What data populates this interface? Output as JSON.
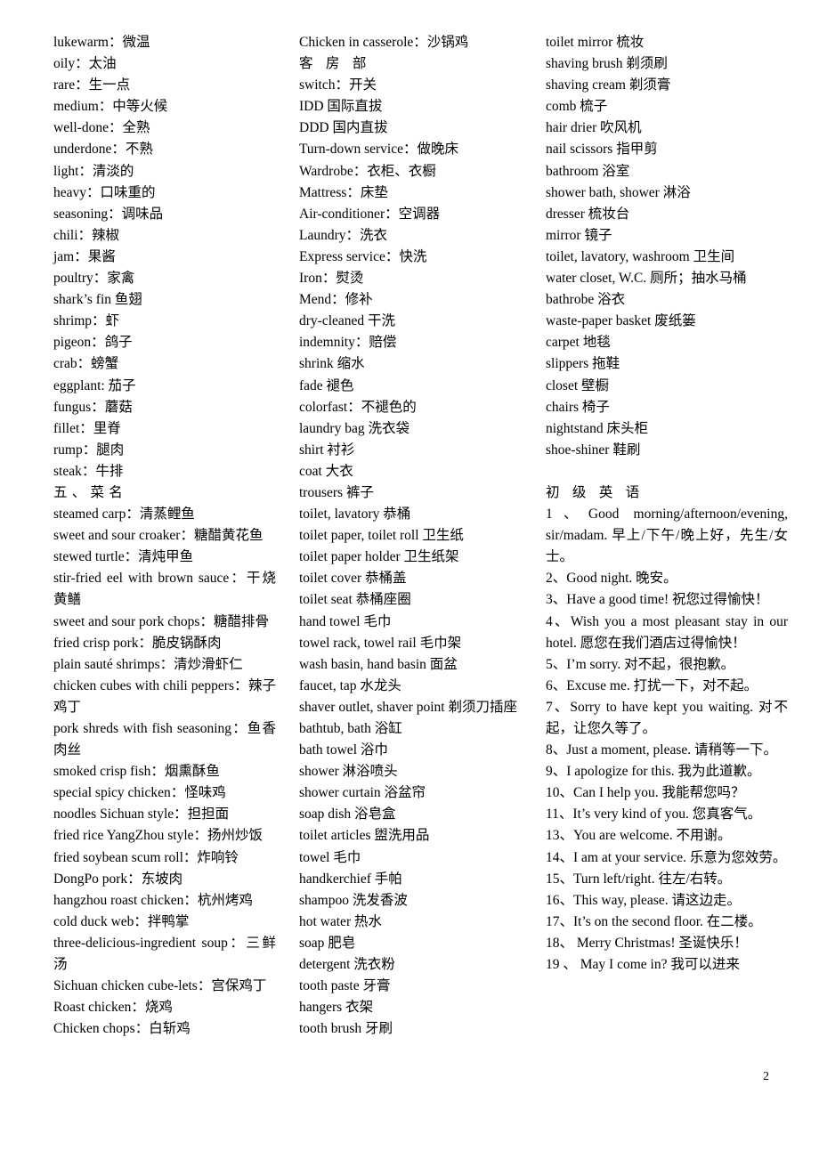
{
  "page": {
    "number": "2"
  },
  "columns": [
    {
      "id": "column-1",
      "entries": [
        {
          "text": "lukewarm：微温"
        },
        {
          "text": "oily：太油"
        },
        {
          "text": "rare：生一点"
        },
        {
          "text": "medium：中等火候"
        },
        {
          "text": "well-done：全熟"
        },
        {
          "text": "underdone：不熟"
        },
        {
          "text": "light：清淡的"
        },
        {
          "text": "heavy：口味重的"
        },
        {
          "text": "seasoning：调味品"
        },
        {
          "text": "chili：辣椒"
        },
        {
          "text": "jam：果酱"
        },
        {
          "text": "poultry：家禽"
        },
        {
          "text": "shark’s fin 鱼翅"
        },
        {
          "text": "shrimp：虾"
        },
        {
          "text": "pigeon：鸽子"
        },
        {
          "text": "crab：螃蟹"
        },
        {
          "text": "eggplant: 茄子"
        },
        {
          "text": "fungus：蘑菇"
        },
        {
          "text": "fillet：里脊"
        },
        {
          "text": "rump：腿肉"
        },
        {
          "text": "steak：牛排"
        },
        {
          "text": "五、菜名",
          "heading": true
        },
        {
          "text": "steamed carp：清蒸鲤鱼"
        },
        {
          "text": "sweet and sour croaker：糖醋黄花鱼"
        },
        {
          "text": "stewed turtle：清炖甲鱼"
        },
        {
          "text": "stir-fried eel with brown sauce：干烧黄鳝",
          "wrap": true
        },
        {
          "text": "sweet and sour pork chops：糖醋排骨",
          "wrap": true
        },
        {
          "text": "fried crisp pork：脆皮锅酥肉"
        },
        {
          "text": "plain sauté shrimps：清炒滑虾仁"
        },
        {
          "text": "chicken cubes with chili peppers：辣子鸡丁",
          "wrap": true
        },
        {
          "text": "pork shreds with fish seasoning：鱼香肉丝",
          "wrap": true
        },
        {
          "text": "smoked crisp fish：烟熏酥鱼"
        },
        {
          "text": "special spicy chicken：怪味鸡"
        },
        {
          "text": "noodles Sichuan style：担担面"
        },
        {
          "text": "fried rice YangZhou style：扬州炒饭"
        },
        {
          "text": "fried soybean scum roll：炸响铃"
        },
        {
          "text": "DongPo pork：东坡肉"
        },
        {
          "text": "hangzhou roast chicken：杭州烤鸡"
        },
        {
          "text": "cold duck web：拌鸭掌"
        },
        {
          "text": "three-delicious-ingredient soup：三鲜汤",
          "wrap": true
        },
        {
          "text": "Sichuan chicken cube-lets：宫保鸡丁"
        },
        {
          "text": "Roast chicken：烧鸡"
        },
        {
          "text": "Chicken chops：白斩鸡"
        }
      ]
    },
    {
      "id": "column-2",
      "entries": [
        {
          "text": "Chicken in casserole：沙锅鸡"
        },
        {
          "text": "客 房 部",
          "heading": true
        },
        {
          "text": "switch：开关"
        },
        {
          "text": "IDD 国际直拔"
        },
        {
          "text": "DDD 国内直拔"
        },
        {
          "text": "Turn-down service：做晚床"
        },
        {
          "text": "Wardrobe：衣柜、衣橱"
        },
        {
          "text": "Mattress：床垫"
        },
        {
          "text": "Air-conditioner：空调器"
        },
        {
          "text": "Laundry：洗衣"
        },
        {
          "text": "Express service：快洗"
        },
        {
          "text": "Iron：熨烫"
        },
        {
          "text": "Mend：修补"
        },
        {
          "text": "dry-cleaned 干洗"
        },
        {
          "text": "indemnity：赔偿"
        },
        {
          "text": "shrink 缩水"
        },
        {
          "text": "fade 褪色"
        },
        {
          "text": "colorfast：不褪色的"
        },
        {
          "text": "laundry bag 洗衣袋"
        },
        {
          "text": "shirt 衬衫"
        },
        {
          "text": "coat 大衣"
        },
        {
          "text": "trousers 裤子"
        },
        {
          "text": "toilet, lavatory 恭桶"
        },
        {
          "text": "toilet paper, toilet roll 卫生纸"
        },
        {
          "text": "toilet paper holder 卫生纸架"
        },
        {
          "text": "toilet cover 恭桶盖"
        },
        {
          "text": "toilet seat 恭桶座圈"
        },
        {
          "text": "hand towel 毛巾"
        },
        {
          "text": "towel rack, towel rail 毛巾架"
        },
        {
          "text": "wash basin, hand basin 面盆"
        },
        {
          "text": "faucet, tap 水龙头"
        },
        {
          "text": "shaver outlet, shaver point 剃须刀插座",
          "wrap": true
        },
        {
          "text": "bathtub, bath 浴缸"
        },
        {
          "text": "bath towel 浴巾"
        },
        {
          "text": "shower 淋浴喷头"
        },
        {
          "text": "shower curtain 浴盆帘"
        },
        {
          "text": "soap dish 浴皂盒"
        },
        {
          "text": "toilet articles 盥洗用品"
        },
        {
          "text": "towel 毛巾"
        },
        {
          "text": "handkerchief 手帕"
        },
        {
          "text": "shampoo 洗发香波"
        },
        {
          "text": "hot  water 热水"
        },
        {
          "text": "soap 肥皂"
        },
        {
          "text": "detergent 洗衣粉"
        },
        {
          "text": "tooth paste 牙膏"
        },
        {
          "text": "hangers 衣架"
        },
        {
          "text": "tooth brush 牙刷"
        }
      ]
    },
    {
      "id": "column-3",
      "entries": [
        {
          "text": "toilet mirror 梳妆"
        },
        {
          "text": "shaving brush 剃须刷"
        },
        {
          "text": "shaving cream 剃须膏"
        },
        {
          "text": "comb 梳子"
        },
        {
          "text": "hair drier 吹风机"
        },
        {
          "text": "nail scissors 指甲剪"
        },
        {
          "text": "bathroom 浴室"
        },
        {
          "text": "shower bath, shower 淋浴"
        },
        {
          "text": "dresser 梳妆台"
        },
        {
          "text": "mirror 镜子"
        },
        {
          "text": "toilet, lavatory, washroom 卫生间"
        },
        {
          "text": "water closet, W.C. 厕所；抽水马桶"
        },
        {
          "text": "bathrobe 浴衣"
        },
        {
          "text": "waste-paper basket 废纸篓"
        },
        {
          "text": "carpet 地毯"
        },
        {
          "text": "slippers 拖鞋"
        },
        {
          "text": "closet 壁橱"
        },
        {
          "text": "chairs 椅子"
        },
        {
          "text": "nightstand 床头柜"
        },
        {
          "text": "shoe-shiner 鞋刷"
        },
        {
          "text": "",
          "spacer": true
        },
        {
          "text": "初 级 英 语",
          "heading": true
        },
        {
          "text": "1、Good morning/afternoon/evening, sir/madam. 早上/下午/晚上好，先生/女士。",
          "wrap": true
        },
        {
          "text": "2、Good night. 晚安。"
        },
        {
          "text": "3、Have a good time!  祝您过得愉快！",
          "wrap": true
        },
        {
          "text": "4、Wish you a most pleasant stay in our hotel.  愿您在我们酒店过得愉快！",
          "wrap": true
        },
        {
          "text": "5、I’m sorry.  对不起，很抱歉。"
        },
        {
          "text": "6、Excuse me. 打扰一下，对不起。"
        },
        {
          "text": "7、Sorry to have kept you waiting. 对不起，让您久等了。",
          "wrap": true
        },
        {
          "text": "8、Just a moment, please. 请稍等一下。",
          "wrap": true
        },
        {
          "text": "9、I apologize for this. 我为此道歉。"
        },
        {
          "text": "10、Can I help you. 我能帮您吗？"
        },
        {
          "text": "11、It’s very kind of you.  您真客气。"
        },
        {
          "text": "13、You are welcome.  不用谢。"
        },
        {
          "text": "14、I am at your service. 乐意为您效劳。",
          "wrap": true
        },
        {
          "text": "15、Turn left/right.  往左/右转。"
        },
        {
          "text": "16、This way, please. 请这边走。"
        },
        {
          "text": "17、It’s on the second floor. 在二楼。"
        },
        {
          "text": "18、 Merry Christmas! 圣诞快乐！"
        },
        {
          "text": "19 、 May I come in? 我可以进来",
          "wrap": true
        }
      ]
    }
  ]
}
